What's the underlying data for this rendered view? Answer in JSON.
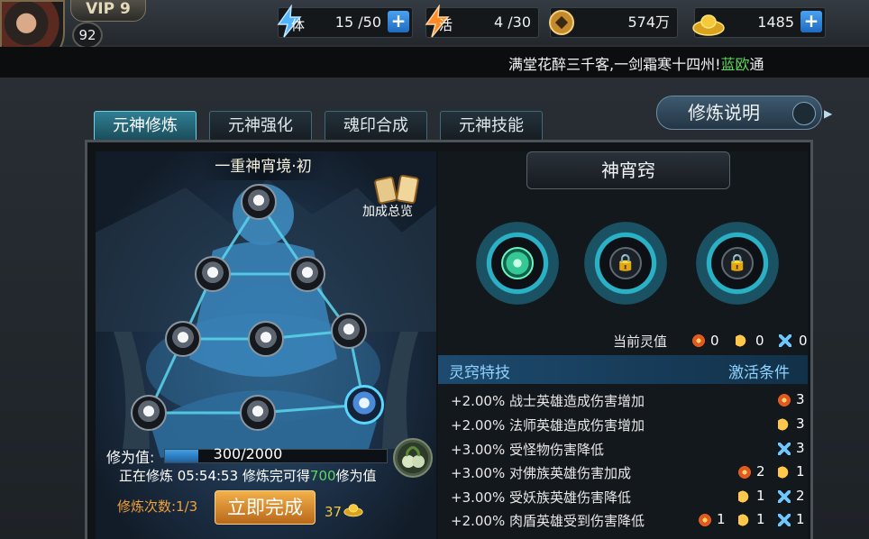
{
  "player": {
    "vip": "VIP 9",
    "level": "92"
  },
  "resources": {
    "stamina": {
      "label": "体",
      "value": "15 /50"
    },
    "vigor": {
      "label": "活",
      "value": "4 /30"
    },
    "coins": {
      "value": "574万"
    },
    "ingots": {
      "value": "1485"
    }
  },
  "marquee": {
    "text": "满堂花醉三千客,一剑霜寒十四州!",
    "player_name": "蓝欧",
    "tail": "通"
  },
  "tabs": [
    {
      "label": "元神修炼",
      "active": true
    },
    {
      "label": "元神强化",
      "active": false
    },
    {
      "label": "魂印合成",
      "active": false
    },
    {
      "label": "元神技能",
      "active": false
    }
  ],
  "help_button": "修炼说明",
  "left_panel": {
    "realm_title": "一重神宵境·初",
    "bonus_overview": "加成总览",
    "cultivation_label": "修为值:",
    "cultivation_value": "300/2000",
    "cultivation_progress": 0.15,
    "status_prefix": "正在修炼 05:54:53 修炼完可得",
    "status_amount": "700",
    "status_suffix": "修为值",
    "count_label": "修炼次数:1/3",
    "complete_button": "立即完成",
    "complete_cost": "37"
  },
  "right_panel": {
    "title": "神宵窍",
    "current_value_label": "当前灵值",
    "current_values": {
      "fire": "0",
      "moon": "0",
      "star": "0"
    },
    "header_left": "灵窍特技",
    "header_right": "激活条件",
    "skills": [
      {
        "text": "+2.00%  战士英雄造成伤害增加",
        "conds": [
          {
            "icon": "fire",
            "n": "3"
          }
        ]
      },
      {
        "text": "+2.00%  法师英雄造成伤害增加",
        "conds": [
          {
            "icon": "moon",
            "n": "3"
          }
        ]
      },
      {
        "text": "+3.00%  受怪物伤害降低",
        "conds": [
          {
            "icon": "star",
            "n": "3"
          }
        ]
      },
      {
        "text": "+3.00%  对佛族英雄伤害加成",
        "conds": [
          {
            "icon": "fire",
            "n": "2"
          },
          {
            "icon": "moon",
            "n": "1"
          }
        ]
      },
      {
        "text": "+3.00%  受妖族英雄伤害降低",
        "conds": [
          {
            "icon": "moon",
            "n": "1"
          },
          {
            "icon": "star",
            "n": "2"
          }
        ]
      },
      {
        "text": "+2.00%  肉盾英雄受到伤害降低",
        "conds": [
          {
            "icon": "fire",
            "n": "1"
          },
          {
            "icon": "moon",
            "n": "1"
          },
          {
            "icon": "star",
            "n": "1"
          }
        ]
      }
    ]
  },
  "icons": {
    "coin": "copper-coin-icon",
    "ingot": "gold-ingot-icon",
    "lock": "lock-icon",
    "gem": "jade-gem-icon"
  },
  "colors": {
    "accent": "#6fd2e8",
    "highlight_green": "#5fd65f",
    "header_blue": "#8fd3ff",
    "button_orange": "#f2b04a"
  }
}
